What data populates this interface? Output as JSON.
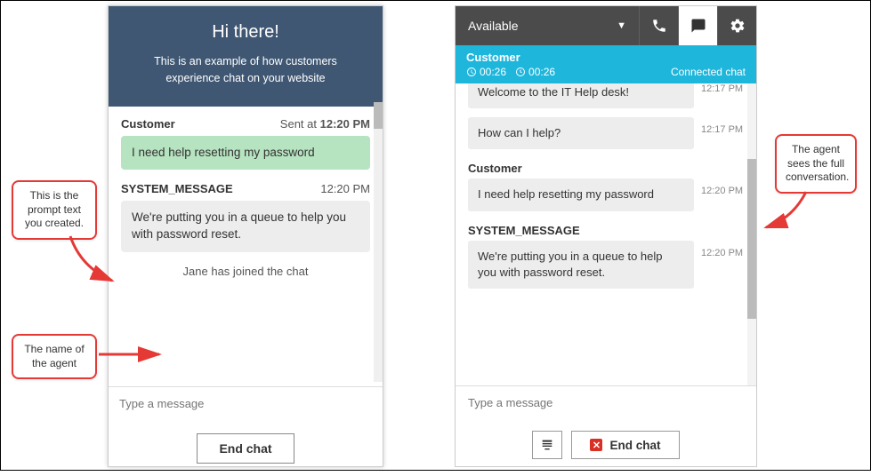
{
  "customer": {
    "header_title": "Hi there!",
    "header_sub": "This is an example of how customers experience chat on your website",
    "messages": [
      {
        "sender": "Customer",
        "time_prefix": "Sent at",
        "time": "12:20 PM",
        "text": "I need help resetting my password",
        "style": "green"
      },
      {
        "sender": "SYSTEM_MESSAGE",
        "time_prefix": "",
        "time": "12:20 PM",
        "text": "We're putting you in a queue to help you with password reset.",
        "style": "grey"
      }
    ],
    "join_text": "Jane has joined the chat",
    "input_placeholder": "Type a message",
    "end_chat_label": "End chat"
  },
  "agent": {
    "status_label": "Available",
    "customer_label": "Customer",
    "time1": "00:26",
    "time2": "00:26",
    "connected_label": "Connected chat",
    "messages": [
      {
        "sender": "",
        "text": "Welcome to the IT Help desk!",
        "time": "12:17 PM"
      },
      {
        "sender": "",
        "text": "How can I help?",
        "time": "12:17 PM"
      },
      {
        "sender": "Customer",
        "text": "I need help resetting my password",
        "time": "12:20 PM"
      },
      {
        "sender": "SYSTEM_MESSAGE",
        "text": "We're putting you in a queue to help you with password reset.",
        "time": "12:20 PM"
      }
    ],
    "input_placeholder": "Type a message",
    "end_chat_label": "End chat"
  },
  "callouts": {
    "c1": "This is the prompt text you created.",
    "c2": "The name of the agent",
    "c3": "The agent sees the full conversation."
  }
}
